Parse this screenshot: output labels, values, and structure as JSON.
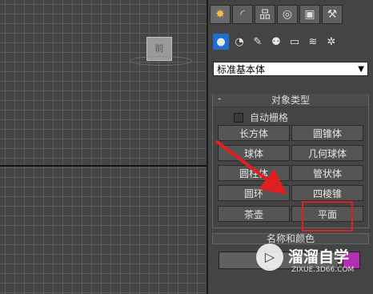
{
  "viewport": {
    "viewcube_label": "前"
  },
  "command_panel": {
    "tabs": [
      {
        "icon": "create-icon",
        "glyph": "✸"
      },
      {
        "icon": "modify-icon",
        "glyph": "◜"
      },
      {
        "icon": "hierarchy-icon",
        "glyph": "品"
      },
      {
        "icon": "motion-icon",
        "glyph": "◎"
      },
      {
        "icon": "display-icon",
        "glyph": "▣"
      },
      {
        "icon": "utilities-icon",
        "glyph": "⚒"
      }
    ],
    "subcategories": [
      {
        "icon": "geometry-icon",
        "glyph": "●"
      },
      {
        "icon": "shapes-icon",
        "glyph": "◔"
      },
      {
        "icon": "lights-icon",
        "glyph": "✎"
      },
      {
        "icon": "cameras-icon",
        "glyph": "⚉"
      },
      {
        "icon": "helpers-icon",
        "glyph": "▭"
      },
      {
        "icon": "space-warps-icon",
        "glyph": "≋"
      },
      {
        "icon": "systems-icon",
        "glyph": "✲"
      }
    ],
    "dropdown_value": "标准基本体",
    "object_type": {
      "title": "对象类型",
      "toggle": "-",
      "autogrid_label": "自动栅格",
      "buttons": [
        "长方体",
        "圆锥体",
        "球体",
        "几何球体",
        "圆柱体",
        "管状体",
        "圆环",
        "四棱锥",
        "茶壶",
        "平面"
      ]
    },
    "name_and_color": {
      "title": "名称和颜色",
      "toggle": "-"
    }
  },
  "watermark": {
    "name": "溜溜自学",
    "url": "ZIXUE.3D66.COM",
    "play_glyph": "▷"
  },
  "colors": {
    "highlight": "#e02020",
    "active_tab": "#1f6fd0",
    "swatch": "#b030b0"
  }
}
